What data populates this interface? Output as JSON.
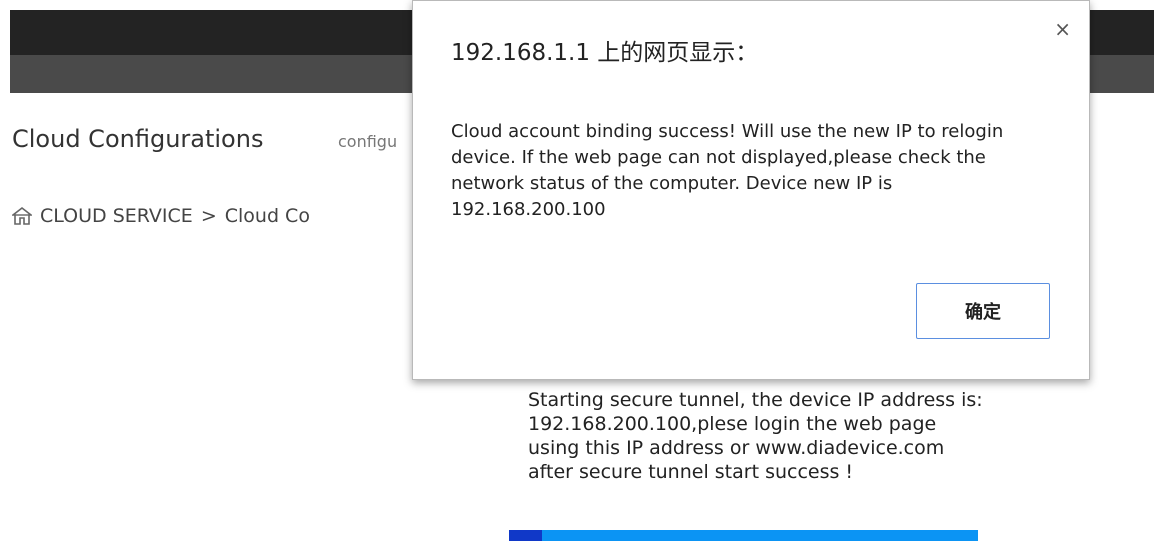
{
  "header": {
    "page_title": "Cloud Configurations",
    "page_subtitle": "configu"
  },
  "breadcrumb": {
    "home_icon": "home-icon",
    "section": "CLOUD SERVICE",
    "separator": ">",
    "page": "Cloud Co"
  },
  "status": {
    "message": "Starting secure tunnel, the device IP address is: 192.168.200.100,plese login the web page using this IP address or www.diadevice.com after secure tunnel start success !",
    "progress_percent": 7
  },
  "dialog": {
    "title": "192.168.1.1 上的网页显示：",
    "close_glyph": "×",
    "message": "Cloud account binding success! Will use the new IP to relogin device. If the web page can not displayed,please check the network status of the computer. Device new IP is 192.168.200.100",
    "ok_label": "确定"
  },
  "colors": {
    "top_bar": "#232323",
    "sub_bar": "#4a4a4a",
    "progress_track": "#0b94f4",
    "progress_fill": "#1038c8",
    "dialog_button_border": "#5b8fe0"
  }
}
